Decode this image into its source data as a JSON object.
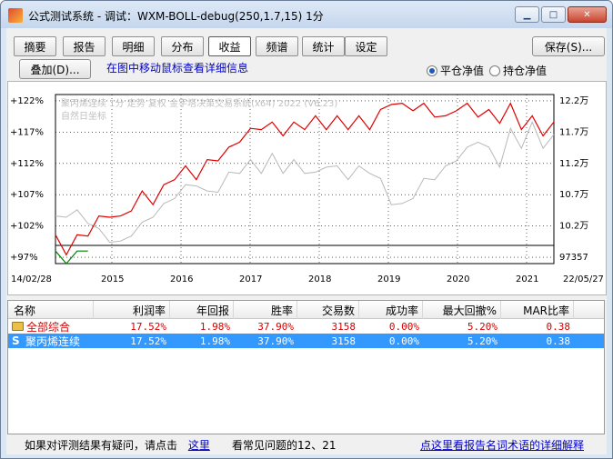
{
  "window": {
    "title": "公式测试系统 - 调试：WXM-BOLL-debug(250,1.7,15) 1分",
    "controls": [
      "minimize-icon",
      "maximize-icon",
      "close-icon"
    ]
  },
  "tabs": [
    {
      "label": "摘要",
      "active": false
    },
    {
      "label": "报告",
      "active": false
    },
    {
      "label": "明细",
      "active": false
    },
    {
      "label": "分布",
      "active": false
    },
    {
      "label": "收益",
      "active": true
    },
    {
      "label": "频谱",
      "active": false
    },
    {
      "label": "统计",
      "active": false
    },
    {
      "label": "设定",
      "active": false
    }
  ],
  "toolbar": {
    "save_label": "保存(S)...",
    "overlay_label": "叠加(D)...",
    "hint": "在图中移动鼠标查看详细信息",
    "radio_flat": "平仓净值",
    "radio_hold": "持仓净值",
    "selected": "平仓净值"
  },
  "chart": {
    "legend_line1": "聚丙烯连续 1分 走势 复权 金字塔决策交易系统(x64) 2022 (V6.23)",
    "legend_line2": "自然日坐标",
    "date_start": "14/02/28",
    "date_end": "22/05/27",
    "colors": {
      "equity": "#e00000",
      "drawdown": "#008000",
      "price": "#b8b8b8"
    }
  },
  "chart_data": {
    "type": "line",
    "x_labels": [
      "2015",
      "2016",
      "2017",
      "2018",
      "2019",
      "2020",
      "2021"
    ],
    "left_axis_ticks": [
      "+122%",
      "+117%",
      "+112%",
      "+107%",
      "+102%",
      "+97%"
    ],
    "right_axis_ticks": [
      "12.2万",
      "11.7万",
      "11.2万",
      "10.7万",
      "10.2万",
      "97357"
    ],
    "series": [
      {
        "values": [
          100,
          98,
          100,
          101,
          103,
          104,
          103,
          105,
          107,
          106,
          108,
          110,
          111,
          110,
          112,
          113,
          114,
          116,
          117,
          118,
          118,
          117,
          118,
          118,
          119,
          118,
          119,
          118,
          119,
          118,
          120,
          122,
          121,
          121,
          121,
          120,
          119,
          121,
          121,
          120,
          120,
          119,
          121,
          118,
          119,
          117,
          118
        ]
      },
      {
        "values": [
          103,
          104,
          104,
          103,
          101,
          100,
          99,
          101,
          102,
          104,
          105,
          107,
          108,
          109,
          107,
          108,
          110,
          111,
          112,
          111,
          113,
          111,
          112,
          111,
          110,
          112,
          111,
          110,
          111,
          111,
          109,
          106,
          105,
          107,
          109,
          110,
          111,
          113,
          114,
          116,
          114,
          112,
          117,
          115,
          118,
          115,
          116
        ]
      }
    ]
  },
  "table": {
    "columns": [
      "名称",
      "利润率",
      "年回报",
      "胜率",
      "交易数",
      "成功率",
      "最大回撤%",
      "MAR比率"
    ],
    "rows": [
      {
        "name": "全部综合",
        "profit": "17.52%",
        "annual": "1.98%",
        "winrate": "37.90%",
        "trades": "3158",
        "success": "0.00%",
        "maxdd": "5.20%",
        "mar": "0.38"
      },
      {
        "name": "聚丙烯连续",
        "profit": "17.52%",
        "annual": "1.98%",
        "winrate": "37.90%",
        "trades": "3158",
        "success": "0.00%",
        "maxdd": "5.20%",
        "mar": "0.38"
      }
    ]
  },
  "footer": {
    "question_text": "如果对评测结果有疑问，请点击",
    "here_link": "这里",
    "faq_text": "看常见问题的12、21",
    "glossary_link": "点这里看报告名词术语的详细解释"
  }
}
